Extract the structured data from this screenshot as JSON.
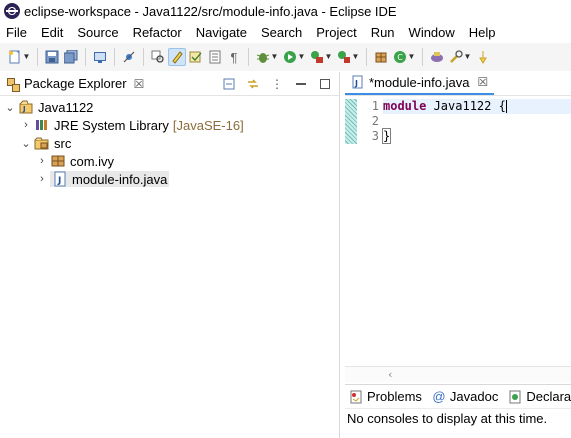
{
  "window": {
    "title": "eclipse-workspace - Java1122/src/module-info.java - Eclipse IDE"
  },
  "menubar": {
    "items": [
      "File",
      "Edit",
      "Source",
      "Refactor",
      "Navigate",
      "Search",
      "Project",
      "Run",
      "Window",
      "Help"
    ]
  },
  "toolbar": {
    "icons": [
      "new-icon",
      "save-icon",
      "save-all-icon",
      "console-icon",
      "skip-breakpoints-icon",
      "open-type-icon",
      "highlight-icon",
      "toggle-mark-icon",
      "toggle-block-icon",
      "show-whitespace-icon",
      "debug-icon",
      "run-icon",
      "coverage-icon",
      "external-tools-icon",
      "new-java-package-icon",
      "new-java-class-icon",
      "open-task-icon",
      "search-icon"
    ]
  },
  "package_explorer": {
    "tab_label": "Package Explorer",
    "tree": [
      {
        "label": "Java1122",
        "level": 0,
        "expanded": true,
        "icon": "java-project-icon"
      },
      {
        "label": "JRE System Library",
        "decoration": "[JavaSE-16]",
        "level": 1,
        "expanded": false,
        "icon": "library-icon"
      },
      {
        "label": "src",
        "level": 1,
        "expanded": true,
        "icon": "source-folder-icon"
      },
      {
        "label": "com.ivy",
        "level": 2,
        "expanded": false,
        "icon": "package-icon"
      },
      {
        "label": "module-info.java",
        "level": 2,
        "expanded": false,
        "icon": "java-file-icon",
        "selected": true
      }
    ]
  },
  "editor": {
    "tab_label": "*module-info.java",
    "line_numbers": [
      "1",
      "2",
      "3"
    ],
    "code": {
      "line1_keyword": "module",
      "line1_rest": " Java1122 ",
      "line1_brace": "{",
      "line3_brace": "}"
    }
  },
  "bottom_panel": {
    "tabs": [
      {
        "label": "Problems",
        "icon": "problems-icon"
      },
      {
        "label": "Javadoc",
        "icon": "javadoc-icon"
      },
      {
        "label": "Declara",
        "icon": "declaration-icon"
      }
    ],
    "message": "No consoles to display at this time."
  }
}
